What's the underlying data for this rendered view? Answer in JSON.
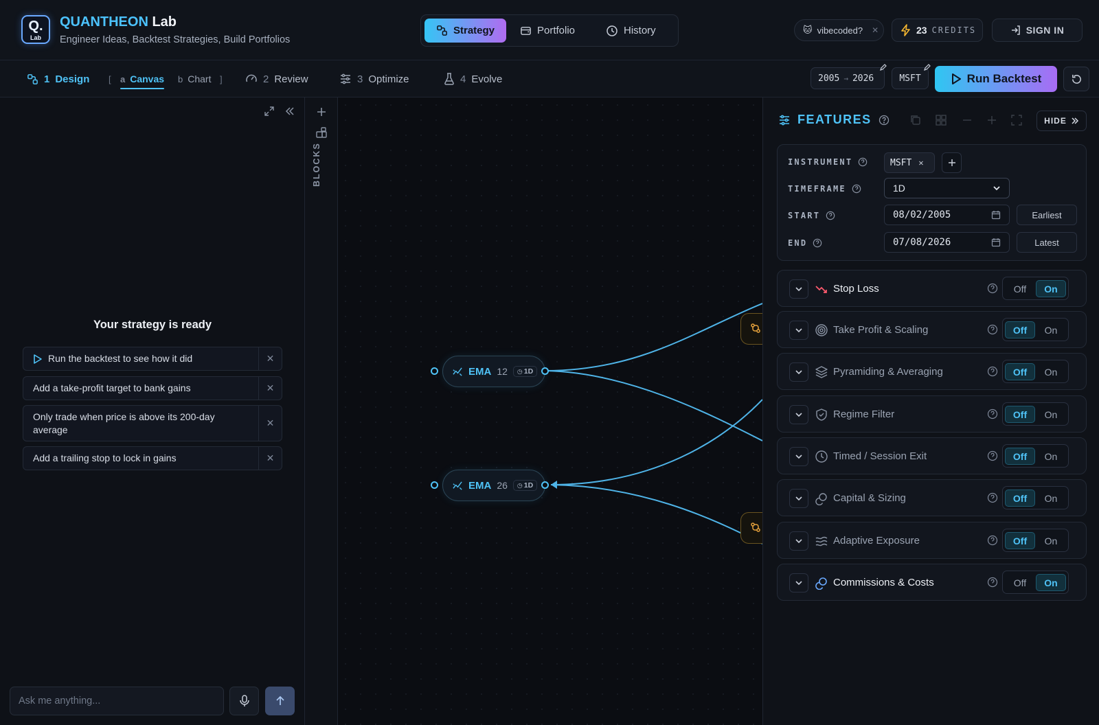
{
  "app": {
    "logo_letter": "Q.",
    "logo_sub": "Lab",
    "brand_primary": "QUANTHEON",
    "brand_secondary": "Lab",
    "tagline": "Engineer Ideas, Backtest Strategies, Build Portfolios"
  },
  "top_nav": {
    "tabs": [
      {
        "label": "Strategy",
        "icon": "strategy-icon",
        "active": true
      },
      {
        "label": "Portfolio",
        "icon": "portfolio-icon",
        "active": false
      },
      {
        "label": "History",
        "icon": "clock-icon",
        "active": false
      }
    ]
  },
  "header_right": {
    "vibe_label": "vibecoded?",
    "credits_count": "23",
    "credits_label": "CREDITS",
    "sign_in": "SIGN IN"
  },
  "steps": {
    "design": {
      "num": "1",
      "label": "Design"
    },
    "canvas": {
      "key": "a",
      "label": "Canvas"
    },
    "chart": {
      "key": "b",
      "label": "Chart"
    },
    "bracket_open": "[",
    "bracket_close": "]",
    "review": {
      "num": "2",
      "label": "Review"
    },
    "optimize": {
      "num": "3",
      "label": "Optimize"
    },
    "evolve": {
      "num": "4",
      "label": "Evolve"
    }
  },
  "toolbar": {
    "range_start": "2005",
    "range_arrow": "→",
    "range_end": "2026",
    "ticker": "MSFT",
    "run_label": "Run Backtest"
  },
  "chat": {
    "ready_title": "Your strategy is ready",
    "suggestions": [
      "Run the backtest to see how it did",
      "Add a take-profit target to bank gains",
      "Only trade when price is above its 200-day average",
      "Add a trailing stop to lock in gains"
    ],
    "input_placeholder": "Ask me anything..."
  },
  "rail": {
    "label": "BLOCKS"
  },
  "canvas": {
    "nodes": [
      {
        "name": "EMA",
        "param": "12",
        "timeframe": "1D"
      },
      {
        "name": "EMA",
        "param": "26",
        "timeframe": "1D"
      }
    ]
  },
  "features": {
    "title": "FEATURES",
    "hide_label": "HIDE",
    "instrument_label": "INSTRUMENT",
    "instrument_value": "MSFT",
    "timeframe_label": "TIMEFRAME",
    "timeframe_value": "1D",
    "start_label": "START",
    "start_value": "08/02/2005",
    "start_button": "Earliest",
    "end_label": "END",
    "end_value": "07/08/2026",
    "end_button": "Latest",
    "off_label": "Off",
    "on_label": "On",
    "items": [
      {
        "name": "Stop Loss",
        "enabled": true,
        "icon": "trend-down-icon"
      },
      {
        "name": "Take Profit & Scaling",
        "enabled": false,
        "icon": "target-icon"
      },
      {
        "name": "Pyramiding & Averaging",
        "enabled": false,
        "icon": "layers-icon"
      },
      {
        "name": "Regime Filter",
        "enabled": false,
        "icon": "shield-icon"
      },
      {
        "name": "Timed / Session Exit",
        "enabled": false,
        "icon": "clock-icon"
      },
      {
        "name": "Capital & Sizing",
        "enabled": false,
        "icon": "coins-icon"
      },
      {
        "name": "Adaptive Exposure",
        "enabled": false,
        "icon": "waves-icon"
      },
      {
        "name": "Commissions & Costs",
        "enabled": true,
        "icon": "commission-icon"
      }
    ]
  },
  "colors": {
    "accent": "#4fc3f7",
    "accent_purple": "#b06cf0",
    "background": "#0d1016",
    "stop_loss_red": "#ff5a6e",
    "node_orange": "#e6a23c"
  }
}
